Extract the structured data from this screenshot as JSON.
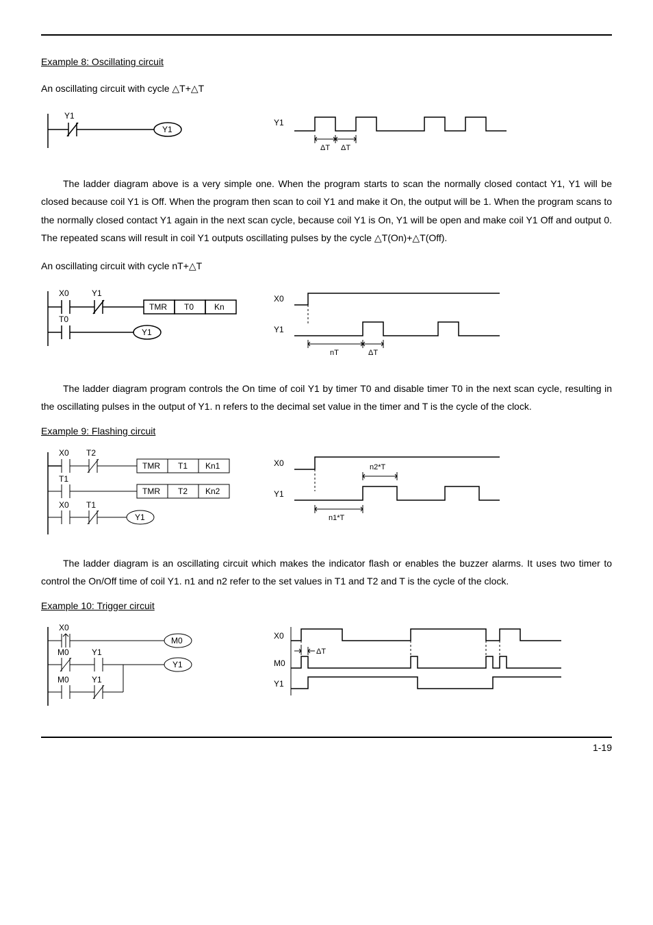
{
  "example8": {
    "title": "Example 8: Oscillating circuit",
    "intro": "An oscillating circuit with cycle  △T+△T",
    "ladder": {
      "y1_label": "Y1",
      "y1_coil": "Y1"
    },
    "timing": {
      "y1": "Y1",
      "dt1": "ΔT",
      "dt2": "ΔT"
    },
    "para": "The ladder diagram above is a very simple one. When the program starts to scan the normally closed contact Y1, Y1 will be closed because coil Y1 is Off. When the program then scan to coil Y1 and make it On, the output will be 1. When the program scans to the normally closed contact Y1 again in the next scan cycle, because coil Y1 is On, Y1 will be open and make coil Y1 Off and output 0. The repeated scans will result in coil Y1 outputs oscillating pulses by the cycle  △T(On)+△T(Off).",
    "intro2": "An oscillating circuit with cycle nT+△T",
    "ladder2": {
      "x0": "X0",
      "y1": "Y1",
      "tmr": "TMR",
      "t0": "T0",
      "kn": "Kn",
      "t0b": "T0",
      "y1_coil": "Y1"
    },
    "timing2": {
      "x0": "X0",
      "y1": "Y1",
      "nt": "nT",
      "dt": "ΔT"
    },
    "para2": "The ladder diagram program controls the On time of coil Y1 by timer T0 and disable timer T0 in the next scan cycle, resulting in the oscillating pulses in the output of Y1. n refers to the decimal set value in the timer and T is the cycle of the clock."
  },
  "example9": {
    "title": "Example 9: Flashing circuit",
    "ladder": {
      "x0": "X0",
      "t2": "T2",
      "tmr1": "TMR",
      "t1": "T1",
      "kn1": "Kn1",
      "t1b": "T1",
      "tmr2": "TMR",
      "t2b": "T2",
      "kn2": "Kn2",
      "x0b": "X0",
      "t1c": "T1",
      "y1": "Y1"
    },
    "timing": {
      "x0": "X0",
      "y1": "Y1",
      "n2t": "n2*T",
      "n1t": "n1*T"
    },
    "para": "The ladder diagram is an oscillating circuit which makes the indicator flash or enables the buzzer alarms. It uses two timer to control the On/Off time of coil Y1. n1 and n2 refer to the set values in T1 and T2 and T is the cycle of the clock."
  },
  "example10": {
    "title": "Example 10: Trigger circuit",
    "ladder": {
      "x0": "X0",
      "m0": "M0",
      "m0b": "M0",
      "y1": "Y1",
      "y1c": "Y1",
      "m0c": "M0",
      "y1b": "Y1"
    },
    "timing": {
      "x0": "X0",
      "m0": "M0",
      "y1": "Y1",
      "dt": "ΔT"
    }
  },
  "footer": "1-19"
}
